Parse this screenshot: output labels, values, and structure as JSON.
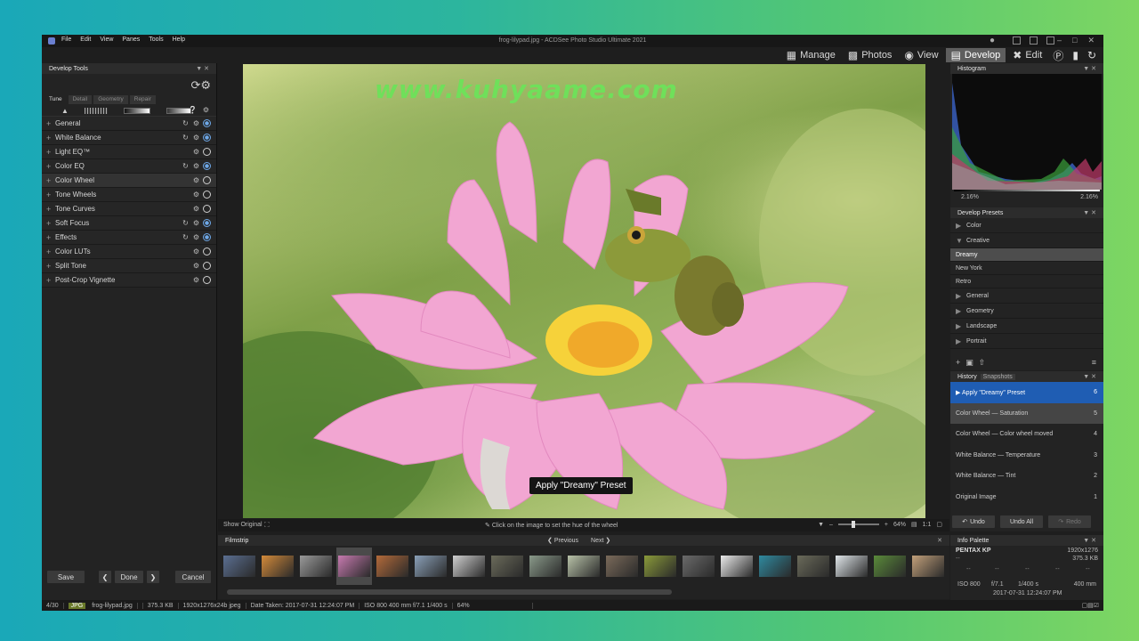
{
  "window": {
    "title": "frog-lilypad.jpg - ACDSee Photo Studio Ultimate 2021",
    "menu": [
      "File",
      "Edit",
      "View",
      "Panes",
      "Tools",
      "Help"
    ]
  },
  "modes": {
    "manage": "Manage",
    "photos": "Photos",
    "view": "View",
    "develop": "Develop",
    "edit": "Edit"
  },
  "develop_tools": {
    "title": "Develop Tools",
    "tabs": [
      "Tune",
      "Detail",
      "Geometry",
      "Repair"
    ],
    "items": [
      {
        "label": "General",
        "reset": true,
        "on": true
      },
      {
        "label": "White Balance",
        "reset": true,
        "on": true
      },
      {
        "label": "Light EQ™",
        "reset": false,
        "on": false
      },
      {
        "label": "Color EQ",
        "reset": true,
        "on": true
      },
      {
        "label": "Color Wheel",
        "reset": false,
        "on": false
      },
      {
        "label": "Tone Wheels",
        "reset": false,
        "on": false
      },
      {
        "label": "Tone Curves",
        "reset": false,
        "on": false
      },
      {
        "label": "Soft Focus",
        "reset": true,
        "on": true
      },
      {
        "label": "Effects",
        "reset": true,
        "on": true
      },
      {
        "label": "Color LUTs",
        "reset": false,
        "on": false
      },
      {
        "label": "Split Tone",
        "reset": false,
        "on": false
      },
      {
        "label": "Post-Crop Vignette",
        "reset": false,
        "on": false
      }
    ],
    "save": "Save",
    "done": "Done",
    "cancel": "Cancel"
  },
  "viewer": {
    "watermark": "www.kuhyaame.com",
    "toast": "Apply \"Dreamy\" Preset",
    "show_original": "Show Original",
    "hint": "Click on the image to set the hue of the wheel",
    "zoom": "64%",
    "one_to_one": "1:1"
  },
  "filmstrip": {
    "title": "Filmstrip",
    "previous": "Previous",
    "next": "Next",
    "thumb_colors": [
      "#5b6f92",
      "#d38a3a",
      "#9a9a9a",
      "#c77ab0",
      "#b36a3a",
      "#8aa0b8",
      "#cfcfcf",
      "#6a6a5a",
      "#8a9a8a",
      "#b8c2a8",
      "#7a6a5a",
      "#8a9a3a",
      "#6a6a6a",
      "#eaeaea",
      "#2f8aa0",
      "#6a6a5a",
      "#e0e6ea",
      "#5a8a3a",
      "#c2a07a"
    ],
    "selected_index": 3
  },
  "histogram": {
    "title": "Histogram",
    "left_value": "2.16%",
    "right_value": "2.16%"
  },
  "presets": {
    "title": "Develop Presets",
    "items": [
      {
        "label": "Color",
        "type": "group",
        "open": false
      },
      {
        "label": "Creative",
        "type": "group",
        "open": true
      },
      {
        "label": "Dreamy",
        "type": "preset",
        "selected": true
      },
      {
        "label": "New York",
        "type": "preset"
      },
      {
        "label": "Retro",
        "type": "preset"
      },
      {
        "label": "General",
        "type": "group",
        "open": false
      },
      {
        "label": "Geometry",
        "type": "group",
        "open": false
      },
      {
        "label": "Landscape",
        "type": "group",
        "open": false
      },
      {
        "label": "Portrait",
        "type": "group",
        "open": false
      }
    ]
  },
  "history": {
    "tab_history": "History",
    "tab_snapshots": "Snapshots",
    "items": [
      {
        "label": "Apply \"Dreamy\" Preset",
        "n": "6"
      },
      {
        "label": "Color Wheel — Saturation",
        "n": "5"
      },
      {
        "label": "Color Wheel — Color wheel moved",
        "n": "4"
      },
      {
        "label": "White Balance — Temperature",
        "n": "3"
      },
      {
        "label": "White Balance — Tint",
        "n": "2"
      },
      {
        "label": "Original Image",
        "n": "1"
      }
    ],
    "undo": "Undo",
    "undo_all": "Undo All",
    "redo": "Redo"
  },
  "info_palette": {
    "title": "Info Palette",
    "camera": "PENTAX KP",
    "dimensions": "1920x1276",
    "size": "375.3 KB",
    "iso": "ISO 800",
    "aperture": "f/7.1",
    "shutter": "1/400 s",
    "focal": "400 mm",
    "date": "2017-07-31 12:24:07 PM"
  },
  "status": {
    "count": "4/30",
    "type": "JPG",
    "file": "frog-lilypad.jpg",
    "size": "375.3 KB",
    "dims": "1920x1276x24b jpeg",
    "date": "Date Taken: 2017-07-31 12:24:07 PM",
    "exif": "ISO 800   400 mm   f/7.1   1/400 s",
    "zoom": "64%"
  },
  "colors": {
    "accent_blue": "#1f5db3",
    "watermark_green": "#6fe05a",
    "active_mode": "#5e5e5e"
  }
}
